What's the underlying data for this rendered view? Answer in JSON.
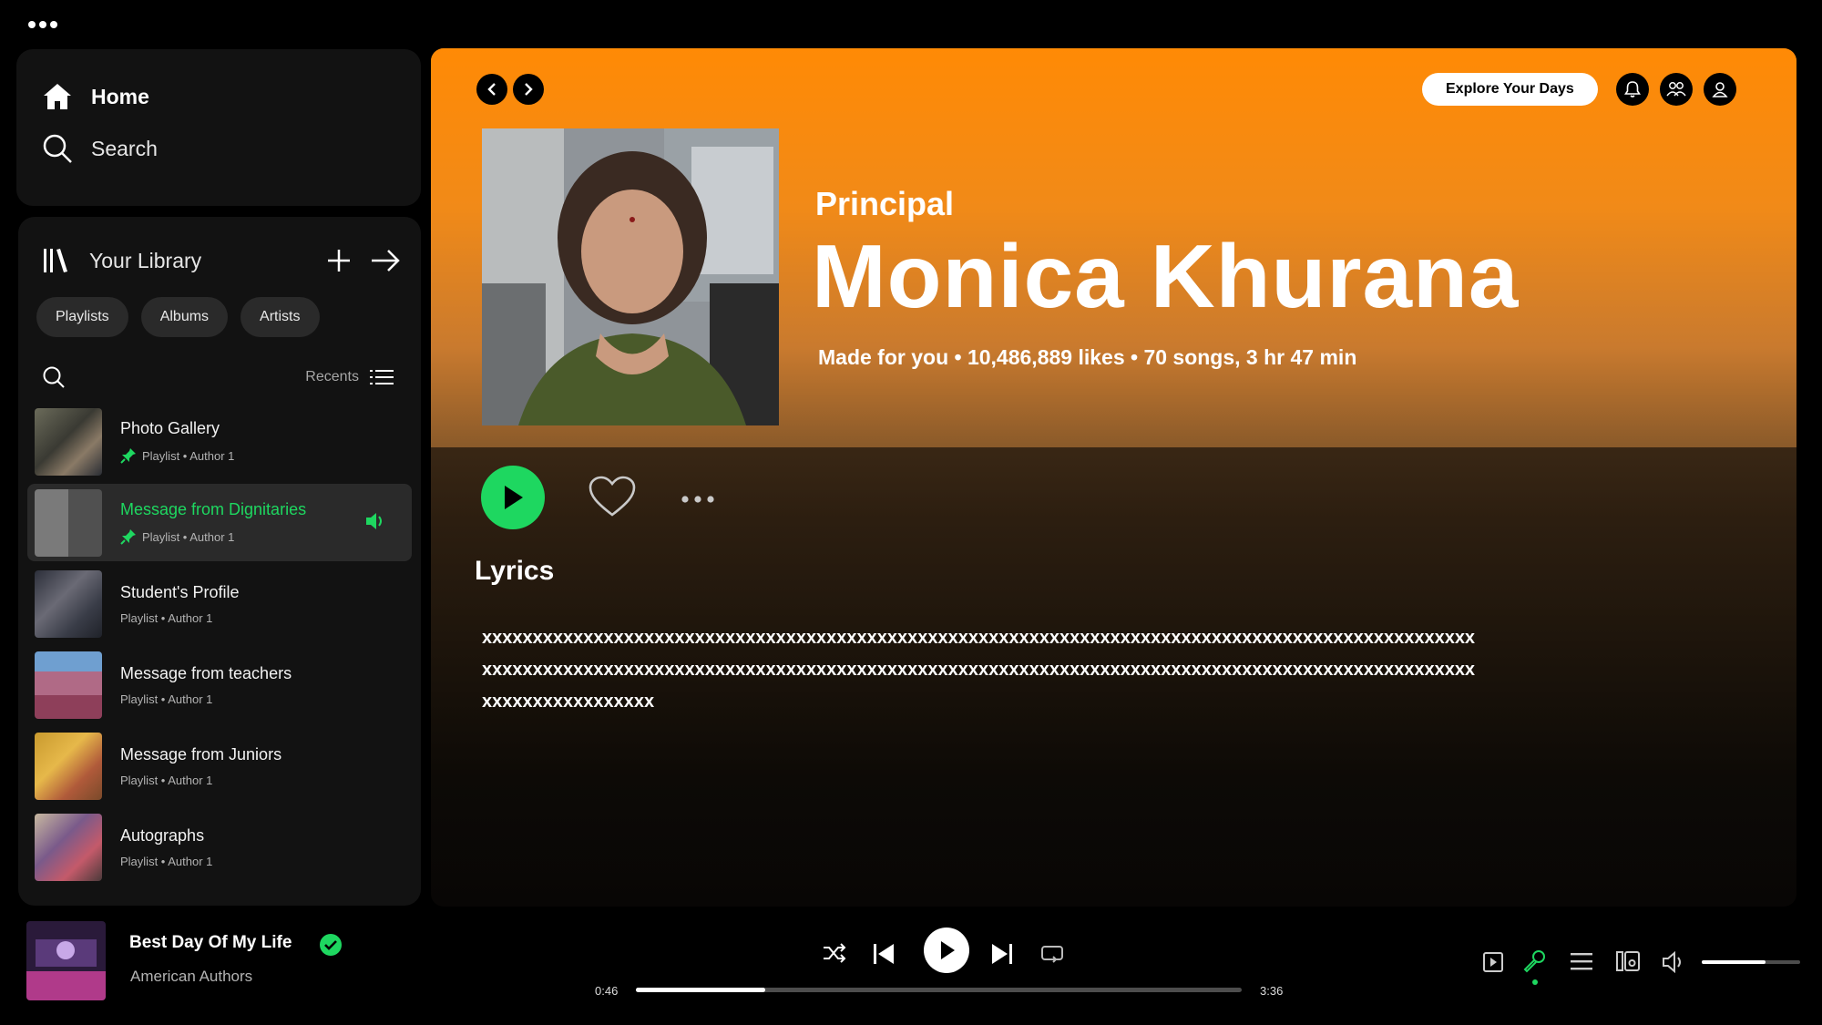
{
  "nav": {
    "home": "Home",
    "search": "Search"
  },
  "library": {
    "title": "Your Library",
    "chips": [
      "Playlists",
      "Albums",
      "Artists"
    ],
    "sort_label": "Recents",
    "items": [
      {
        "title": "Photo Gallery",
        "subtitle": "Playlist • Author 1",
        "pinned": true,
        "active": false
      },
      {
        "title": "Message from Dignitaries",
        "subtitle": "Playlist • Author 1",
        "pinned": true,
        "active": true
      },
      {
        "title": "Student's Profile",
        "subtitle": "Playlist • Author 1",
        "pinned": false,
        "active": false
      },
      {
        "title": "Message from teachers",
        "subtitle": "Playlist • Author 1",
        "pinned": false,
        "active": false
      },
      {
        "title": "Message from Juniors",
        "subtitle": "Playlist • Author 1",
        "pinned": false,
        "active": false
      },
      {
        "title": "Autographs",
        "subtitle": "Playlist • Author 1",
        "pinned": false,
        "active": false
      }
    ]
  },
  "header": {
    "explore_label": "Explore Your Days"
  },
  "hero": {
    "type": "Principal",
    "name": "Monica Khurana",
    "meta": "Made for you • 10,486,889 likes • 70 songs, 3 hr 47 min"
  },
  "lyrics": {
    "title": "Lyrics",
    "text": "xxxxxxxxxxxxxxxxxxxxxxxxxxxxxxxxxxxxxxxxxxxxxxxxxxxxxxxxxxxxxxxxxxxxxxxxxxxxxxxxxxxxxxxxxxxxxxxxxxxxxxxxxxxxxxxxxxxxxxxxxxxxxxxxxxxxxxxxxxxxxxxxxxxxxxxxxxxxxxxxxxxxxxxxxxxxxxxxxxxxxxxxxxxxxxxxxxxxxxxxxxxxxxxxxxxxx"
  },
  "player": {
    "track": "Best Day Of My Life",
    "artist": "American Authors",
    "current_time": "0:46",
    "total_time": "3:36",
    "progress": 0.213,
    "volume": 0.65
  },
  "colors": {
    "accent": "#1ed760",
    "hero_top": "#ff8a05"
  }
}
